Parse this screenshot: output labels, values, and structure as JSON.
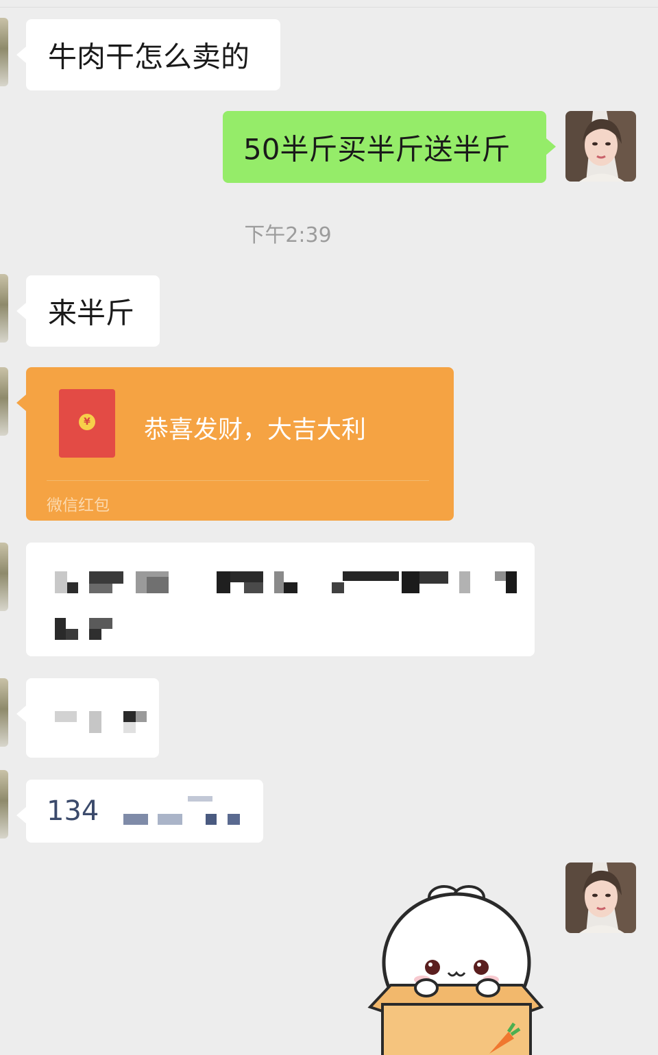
{
  "messages": {
    "m1_text": "牛肉干怎么卖的",
    "m2_text": "50半斤买半斤送半斤",
    "timestamp": "下午2:39",
    "m3_text": "来半斤",
    "red_packet": {
      "title": "恭喜发财，大吉大利",
      "label": "微信红包",
      "coin_symbol": "¥"
    },
    "m7_visible_text": "134"
  },
  "colors": {
    "background": "#ededed",
    "incoming_bubble": "#ffffff",
    "outgoing_bubble": "#95ec69",
    "red_packet": "#f5a343",
    "red_envelope": "#e34b45",
    "timestamp_text": "#9c9c9c"
  },
  "icons": {
    "sticker": "white-bunny-in-box-sticker",
    "red_envelope": "red-envelope-icon"
  }
}
